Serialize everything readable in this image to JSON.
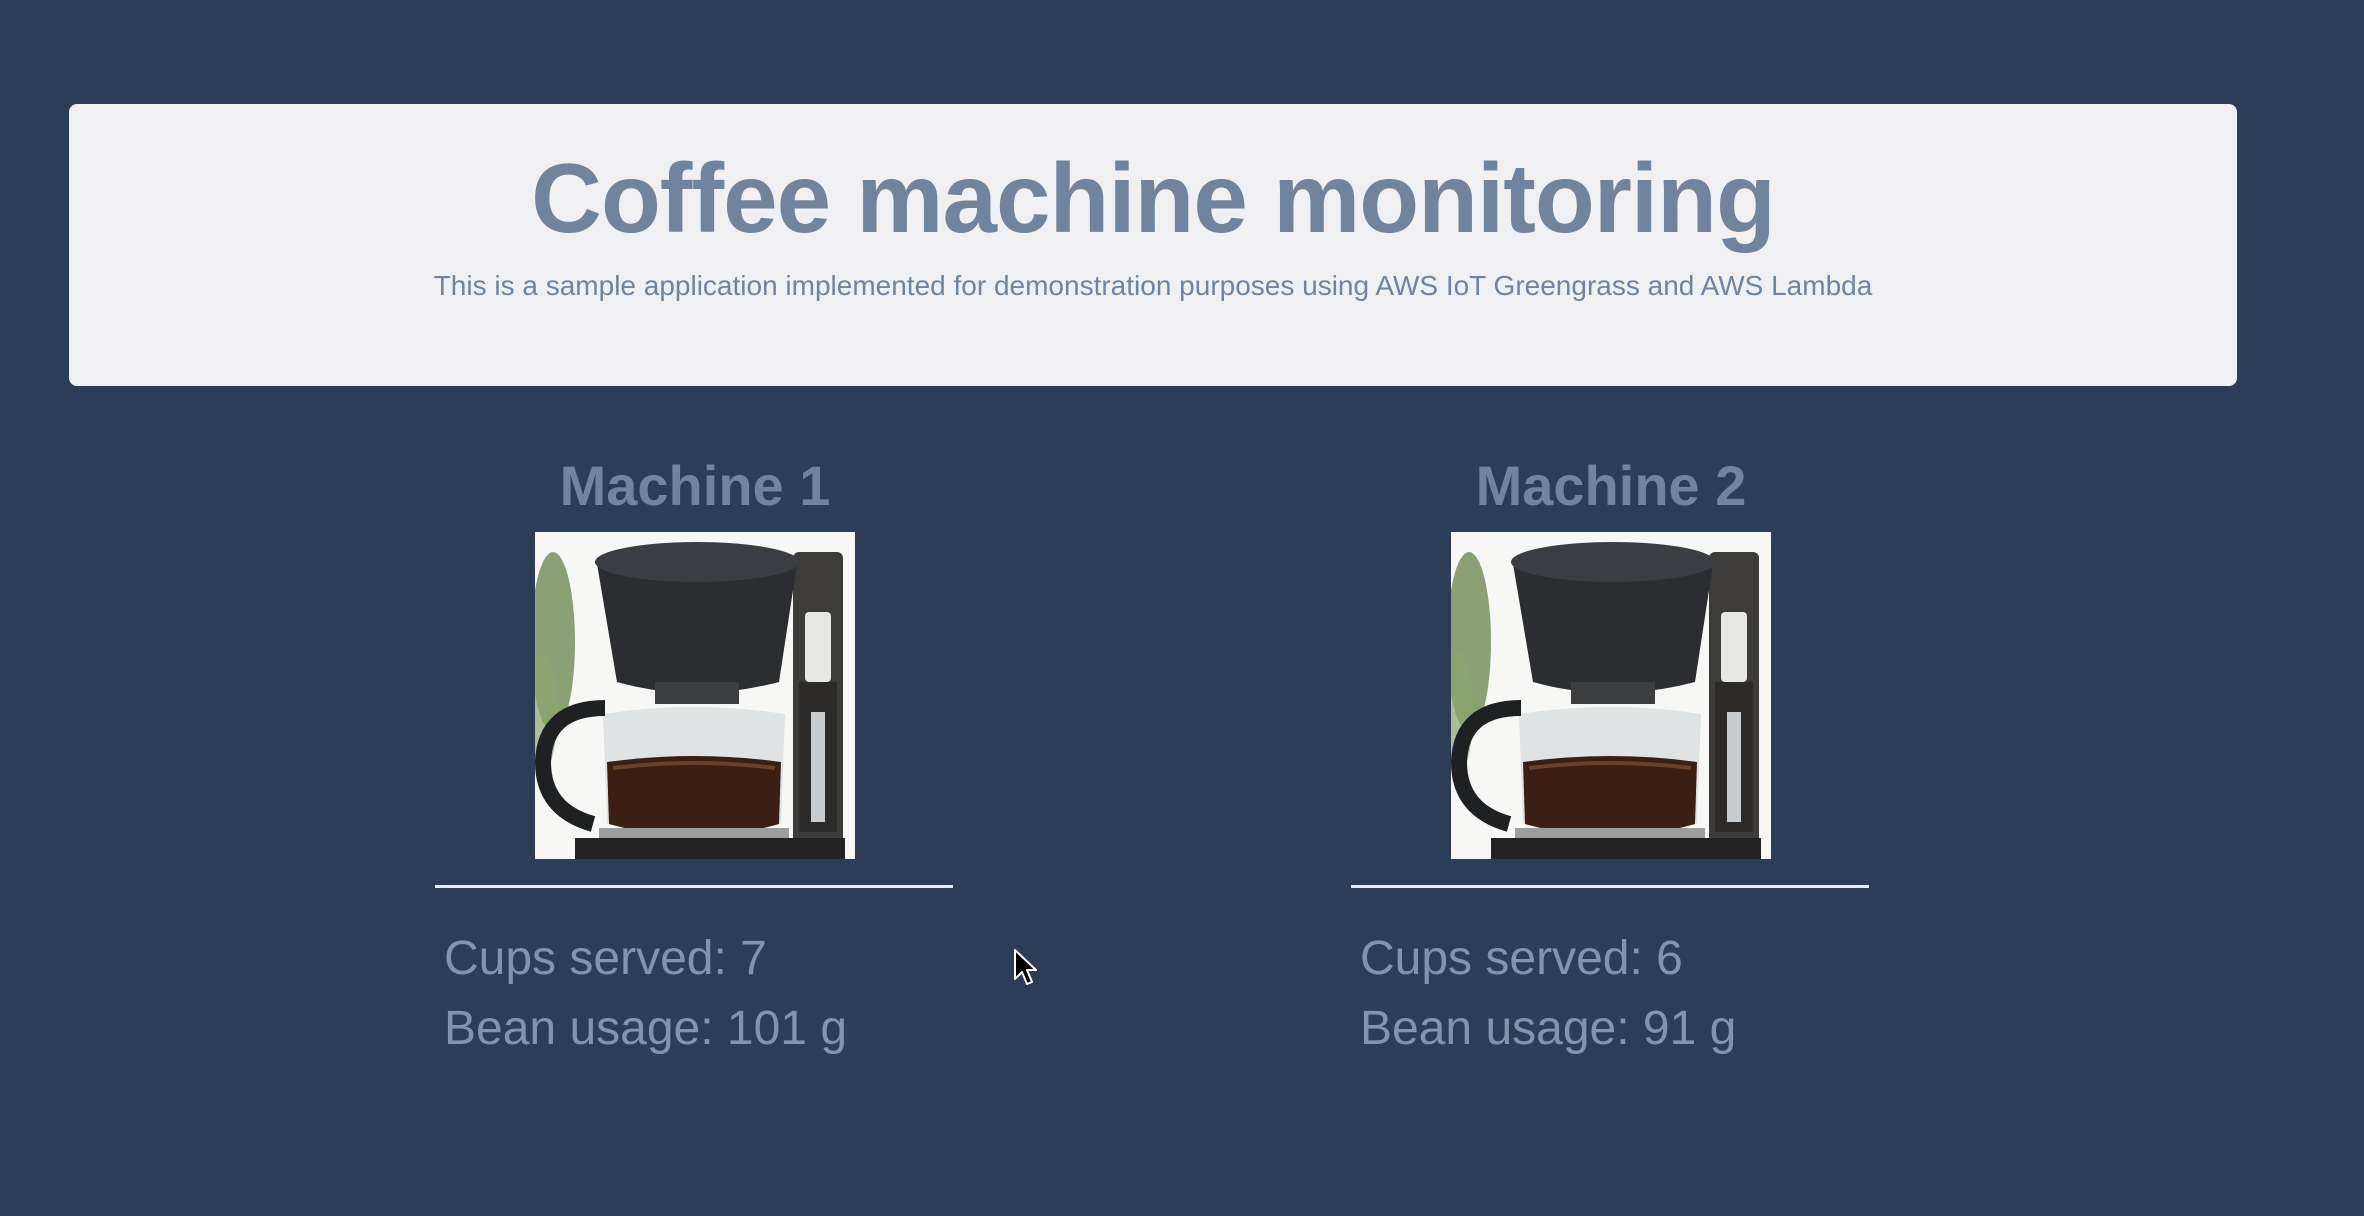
{
  "header": {
    "title": "Coffee machine monitoring",
    "subtitle": "This is a sample application implemented for demonstration purposes using AWS IoT Greengrass and AWS Lambda"
  },
  "machines": [
    {
      "name": "Machine 1",
      "cups_label": "Cups served: 7",
      "beans_label": "Bean usage: 101 g"
    },
    {
      "name": "Machine 2",
      "cups_label": "Cups served: 6",
      "beans_label": "Bean usage: 91 g"
    }
  ],
  "icons": {
    "machine_image": "coffee-maker-photo",
    "cursor": "mouse-pointer-icon"
  },
  "colors": {
    "background": "#2c3e57",
    "panel": "#f0f0f2",
    "title_text": "#71849d",
    "stat_text": "#8294ab",
    "divider": "#e8edf3"
  }
}
